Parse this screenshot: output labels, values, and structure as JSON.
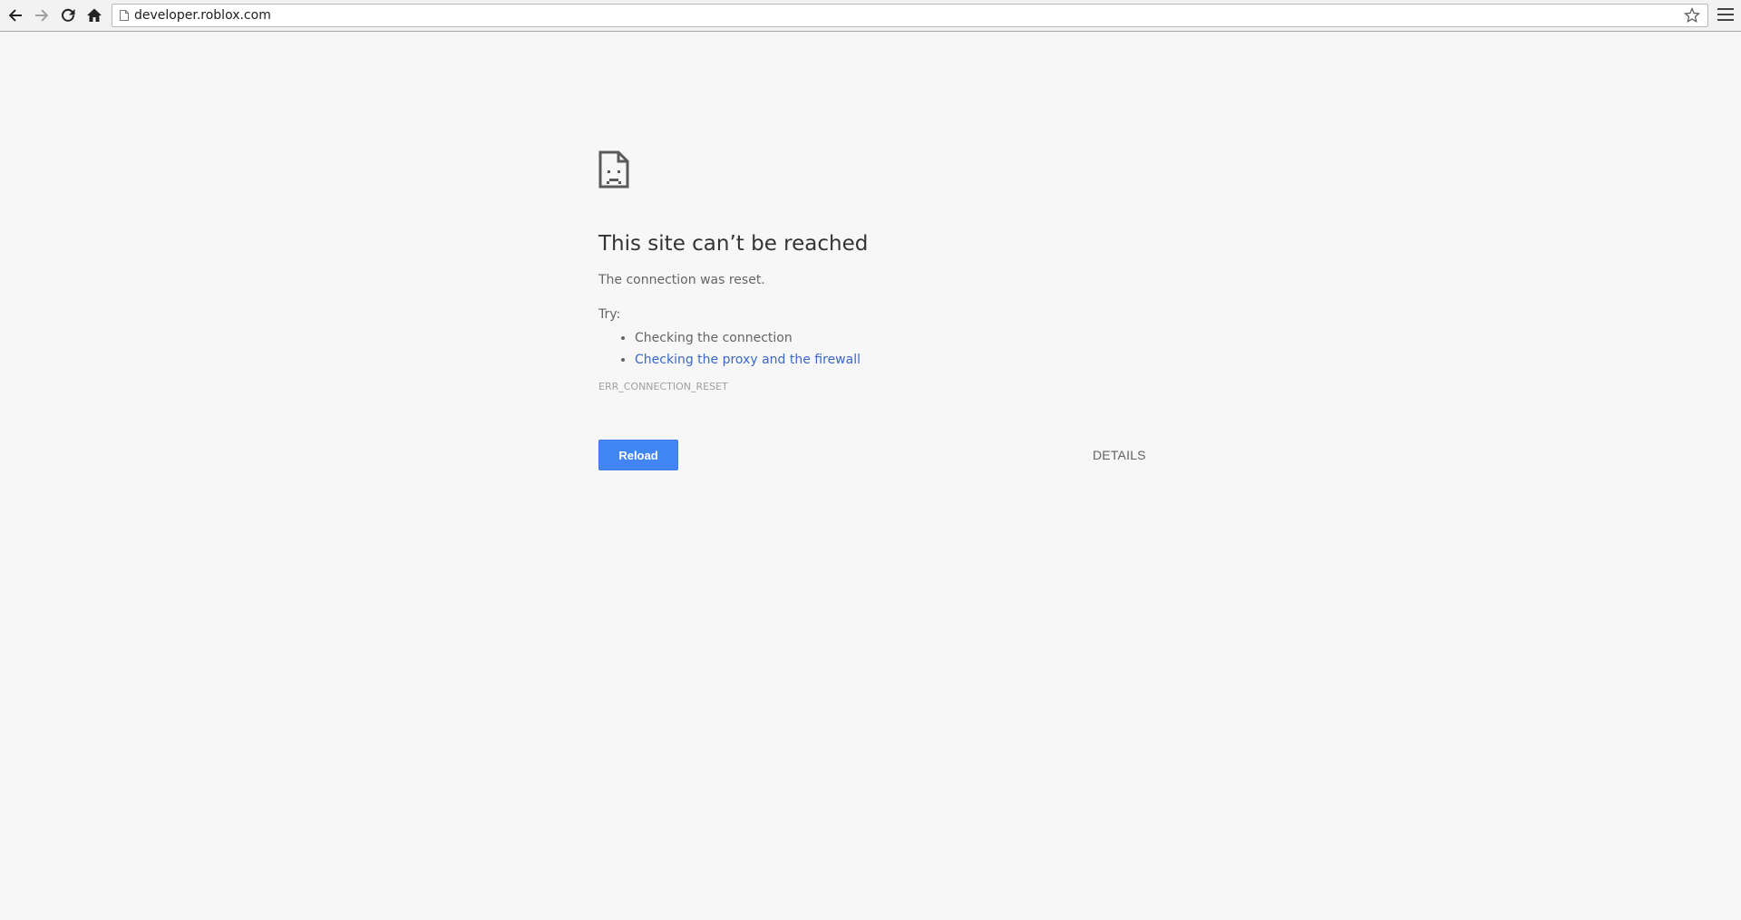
{
  "browser": {
    "url": "developer.roblox.com",
    "icons": {
      "back": "back-arrow-icon",
      "forward": "forward-arrow-icon",
      "reload": "reload-icon",
      "home": "home-icon",
      "page": "page-icon",
      "bookmark": "star-icon",
      "menu": "hamburger-menu-icon"
    }
  },
  "error_page": {
    "icon": "sad-document-icon",
    "headline": "This site can’t be reached",
    "summary": "The connection was reset.",
    "try_label": "Try:",
    "suggestions": [
      {
        "text": "Checking the connection",
        "is_link": false
      },
      {
        "text": "Checking the proxy and the firewall",
        "is_link": true
      }
    ],
    "error_code": "ERR_CONNECTION_RESET",
    "reload_label": "Reload",
    "details_label": "DETAILS"
  },
  "colors": {
    "background": "#f7f7f7",
    "reload_button": "#4285f4",
    "link": "#3b69c4",
    "headline": "#333333"
  }
}
